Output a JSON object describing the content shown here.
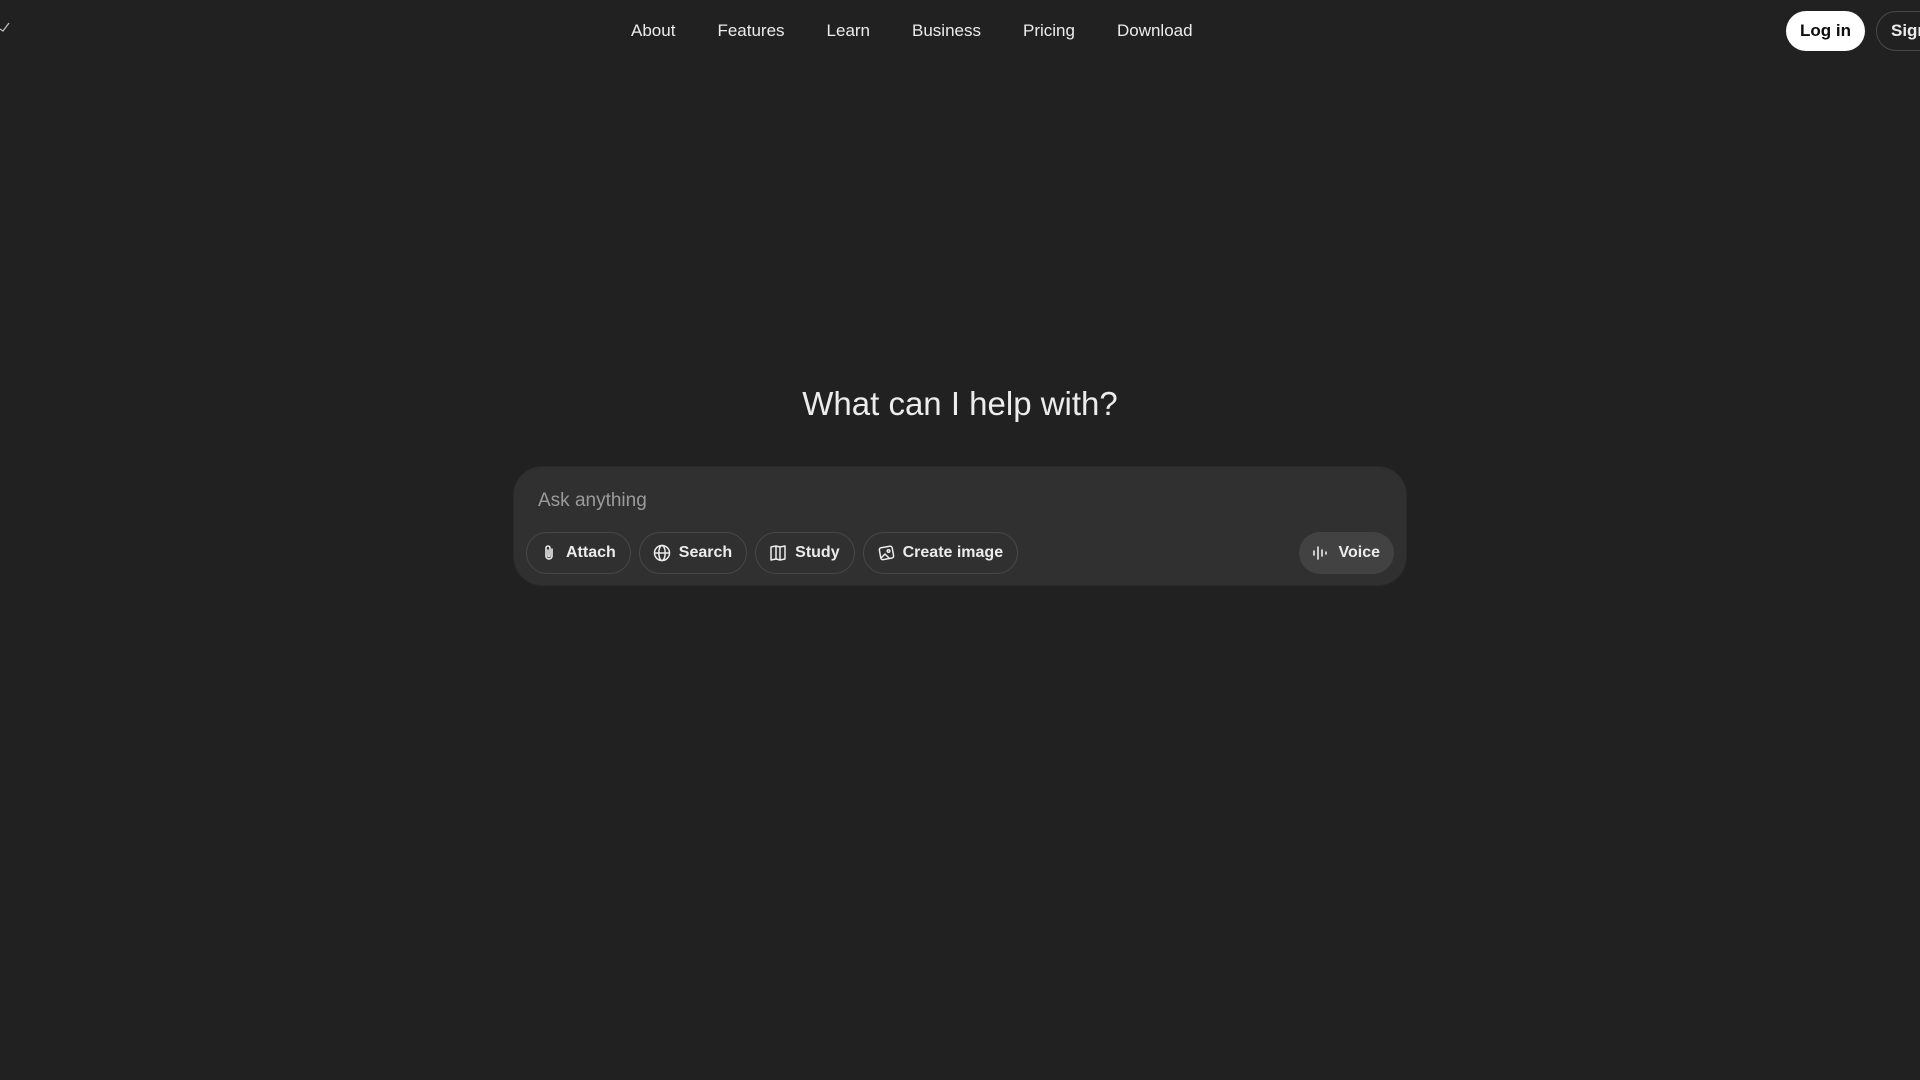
{
  "nav": {
    "links": [
      "About",
      "Features",
      "Learn",
      "Business",
      "Pricing",
      "Download"
    ]
  },
  "auth": {
    "login_label": "Log in",
    "signup_label": "Sign"
  },
  "hero": {
    "title": "What can I help with?"
  },
  "composer": {
    "placeholder": "Ask anything",
    "tools": [
      {
        "label": "Attach",
        "icon": "paperclip-icon"
      },
      {
        "label": "Search",
        "icon": "globe-icon"
      },
      {
        "label": "Study",
        "icon": "book-icon"
      },
      {
        "label": "Create image",
        "icon": "image-icon"
      }
    ],
    "voice_label": "Voice",
    "voice_icon": "waveform-icon"
  },
  "colors": {
    "background": "#212121",
    "composer": "#303030",
    "text": "#ececec",
    "login_bg": "#ffffff"
  }
}
